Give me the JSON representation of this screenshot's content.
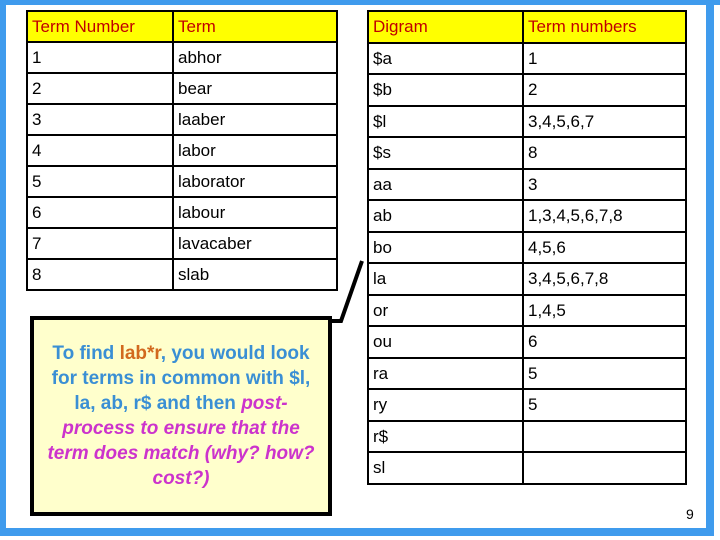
{
  "slide": {
    "page_number": "9",
    "frame_color": "#3f9bed",
    "header_bg": "#ffff00",
    "header_text_color": "#c00000",
    "highlight_color": "#d2691e",
    "callout_bg": "#ffffcc",
    "callout_text_color": "#3a8fd4",
    "callout_emphasis_color": "#cc33cc"
  },
  "left_table": {
    "name": "term-table",
    "headers": [
      "Term Number",
      "Term"
    ],
    "rows": [
      {
        "number": "1",
        "term": "abhor",
        "highlight": false
      },
      {
        "number": "2",
        "term": "bear",
        "highlight": false
      },
      {
        "number": "3",
        "term": "laaber",
        "highlight": false
      },
      {
        "number": "4",
        "term": "labor",
        "highlight": false
      },
      {
        "number": "5",
        "term": "laborator",
        "highlight": false
      },
      {
        "number": "6",
        "term": "labour",
        "highlight": false
      },
      {
        "number": "7",
        "term": "lavacaber",
        "highlight": false
      },
      {
        "number": "8",
        "term": "slab",
        "highlight": false
      }
    ]
  },
  "right_table": {
    "name": "digram-table",
    "headers": [
      "Digram",
      "Term numbers"
    ],
    "rows": [
      {
        "digram": "$a",
        "term_numbers": "1",
        "highlight": false
      },
      {
        "digram": "$b",
        "term_numbers": "2",
        "highlight": false
      },
      {
        "digram": "$l",
        "term_numbers": "3,4,5,6,7",
        "highlight": true
      },
      {
        "digram": "$s",
        "term_numbers": "8",
        "highlight": false
      },
      {
        "digram": "aa",
        "term_numbers": "3",
        "highlight": false
      },
      {
        "digram": "ab",
        "term_numbers": "1,3,4,5,6,7,8",
        "highlight": true
      },
      {
        "digram": "bo",
        "term_numbers": "4,5,6",
        "highlight": false
      },
      {
        "digram": "la",
        "term_numbers": "3,4,5,6,7,8",
        "highlight": true
      },
      {
        "digram": "or",
        "term_numbers": "1,4,5",
        "highlight": false
      },
      {
        "digram": "ou",
        "term_numbers": "6",
        "highlight": false
      },
      {
        "digram": "ra",
        "term_numbers": "5",
        "highlight": false
      },
      {
        "digram": "ry",
        "term_numbers": "5",
        "highlight": false
      },
      {
        "digram": "r$",
        "term_numbers": "",
        "highlight": true
      },
      {
        "digram": "sl",
        "term_numbers": "",
        "highlight": false
      }
    ]
  },
  "callout": {
    "name": "explanation-callout",
    "segments": [
      {
        "text": "To find ",
        "style": "blue"
      },
      {
        "text": "lab*r",
        "style": "orange"
      },
      {
        "text": ", you would look for terms in common with $l, la, ab, r$ and then ",
        "style": "blue"
      },
      {
        "text": "post-process to ensure that the term does match (why? how? cost?)",
        "style": "magenta"
      }
    ],
    "full_text": "To find lab*r, you would look for terms in common with $l, la, ab, r$ and then post-process to ensure that the term does match (why? how? cost?)"
  }
}
